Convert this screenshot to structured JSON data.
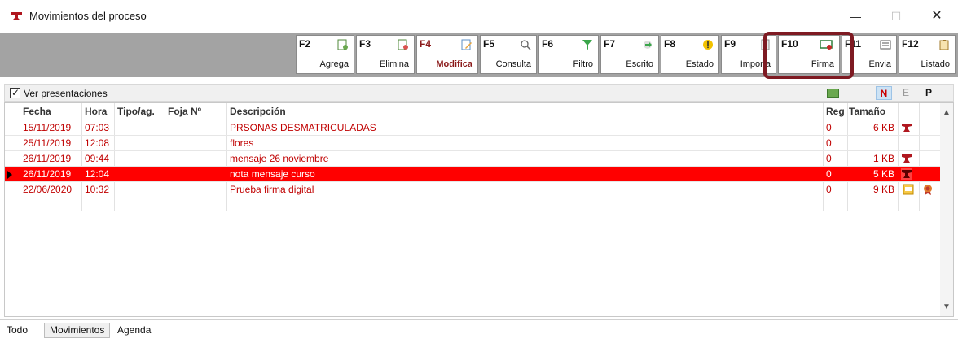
{
  "window": {
    "title": "Movimientos del proceso",
    "controls": {
      "minimize": "—",
      "maximize": "☐",
      "close": "✕"
    }
  },
  "toolbar": {
    "buttons": [
      {
        "key": "F2",
        "label": "Agrega",
        "icon": "add-doc-icon"
      },
      {
        "key": "F3",
        "label": "Elimina",
        "icon": "delete-doc-icon"
      },
      {
        "key": "F4",
        "label": "Modifica",
        "icon": "edit-icon",
        "active": true
      },
      {
        "key": "F5",
        "label": "Consulta",
        "icon": "search-icon"
      },
      {
        "key": "F6",
        "label": "Filtro",
        "icon": "filter-icon"
      },
      {
        "key": "F7",
        "label": "Escrito",
        "icon": "escrito-icon"
      },
      {
        "key": "F8",
        "label": "Estado",
        "icon": "warning-icon"
      },
      {
        "key": "F9",
        "label": "Importa",
        "icon": "import-icon"
      },
      {
        "key": "F10",
        "label": "Firma",
        "icon": "signature-icon"
      },
      {
        "key": "F11",
        "label": "Envia",
        "icon": "send-icon"
      },
      {
        "key": "F12",
        "label": "Listado",
        "icon": "list-icon"
      }
    ],
    "highlighted": "F10"
  },
  "filters": {
    "ver_presentaciones": {
      "label": "Ver presentaciones",
      "checked": true
    },
    "modes": [
      "N",
      "E",
      "P"
    ],
    "active_mode": "N"
  },
  "grid": {
    "columns": [
      "Fecha",
      "Hora",
      "Tipo/ag.",
      "Foja Nº",
      "Descripción",
      "Reg",
      "Tamaño"
    ],
    "rows": [
      {
        "fecha": "15/11/2019",
        "hora": "07:03",
        "tipo": "",
        "foja": "",
        "descripcion": "PRSONAS DESMATRICULADAS",
        "reg": "0",
        "tamano": "6 KB",
        "icons": [
          "anvil-icon"
        ]
      },
      {
        "fecha": "25/11/2019",
        "hora": "12:08",
        "tipo": "",
        "foja": "",
        "descripcion": "flores",
        "reg": "0",
        "tamano": "",
        "icons": []
      },
      {
        "fecha": "26/11/2019",
        "hora": "09:44",
        "tipo": "",
        "foja": "",
        "descripcion": "mensaje 26 noviembre",
        "reg": "0",
        "tamano": "1 KB",
        "icons": [
          "anvil-icon"
        ]
      },
      {
        "fecha": "26/11/2019",
        "hora": "12:04",
        "tipo": "",
        "foja": "",
        "descripcion": "nota mensaje curso",
        "reg": "0",
        "tamano": "5 KB",
        "icons": [
          "anvil-icon"
        ],
        "selected": true
      },
      {
        "fecha": "22/06/2020",
        "hora": "10:32",
        "tipo": "",
        "foja": "",
        "descripcion": "Prueba firma digital",
        "reg": "0",
        "tamano": "9 KB",
        "icons": [
          "certificate-icon",
          "seal-icon"
        ]
      }
    ]
  },
  "tabs": [
    {
      "label": "Todo"
    },
    {
      "label": "Movimientos",
      "active": true
    },
    {
      "label": "Agenda"
    }
  ],
  "colors": {
    "accent": "#8b1a1a",
    "row_text": "#c00000",
    "selected_row": "#ff0000",
    "highlight_ring": "#7e1a22",
    "toolbar_bg": "#a3a3a3"
  }
}
